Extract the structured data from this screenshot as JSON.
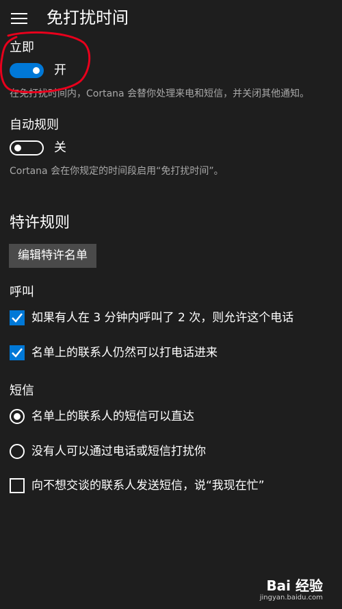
{
  "header": {
    "title": "免打扰时间",
    "menu_icon": "hamburger-icon"
  },
  "immediate": {
    "label": "立即",
    "toggle_on": true,
    "state_text": "开",
    "description": "在免打扰时间内，Cortana 会替你处理来电和短信，并关闭其他通知。"
  },
  "auto_rules": {
    "label": "自动规则",
    "toggle_on": false,
    "state_text": "关",
    "description": "Cortana 会在你规定的时间段启用“免打扰时间”。"
  },
  "exceptions": {
    "title": "特许规则",
    "edit_button": "编辑特许名单"
  },
  "calls": {
    "label": "呼叫",
    "options": [
      {
        "text": "如果有人在 3 分钟内呼叫了 2 次，则允许这个电话",
        "checked": true
      },
      {
        "text": "名单上的联系人仍然可以打电话进来",
        "checked": true
      }
    ]
  },
  "sms": {
    "label": "短信",
    "radios": [
      {
        "text": "名单上的联系人的短信可以直达",
        "selected": true
      },
      {
        "text": "没有人可以通过电话或短信打扰你",
        "selected": false
      }
    ],
    "auto_reply": {
      "text": "向不想交谈的联系人发送短信，说“我现在忙”",
      "checked": false
    }
  },
  "colors": {
    "accent": "#0078d7",
    "background": "#1e1e1e",
    "annotation": "#e8001c"
  },
  "watermark": {
    "logo": "Bai 经验",
    "url": "jingyan.baidu.com"
  }
}
